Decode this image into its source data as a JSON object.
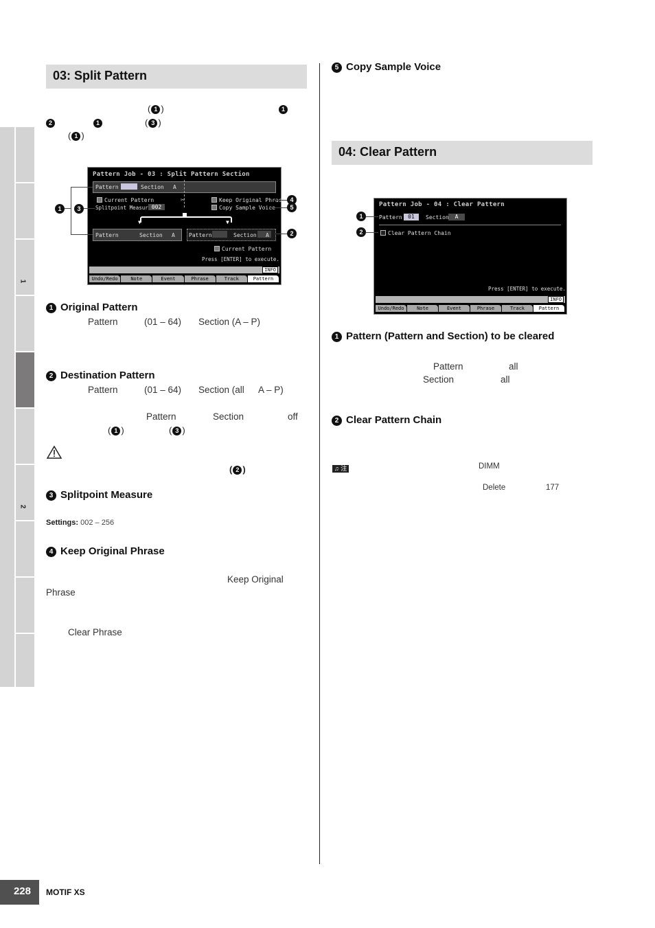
{
  "side_tabs": {
    "labels": [
      "1",
      "2"
    ],
    "active_index": 4
  },
  "left": {
    "section_title": "03: Split Pattern",
    "intro_refs": [
      "(",
      "1",
      ")",
      "1",
      "2",
      "1",
      "(",
      "3",
      ")",
      "(",
      "1",
      ")"
    ],
    "screen": {
      "title": "Pattern Job - 03 : Split Pattern Section",
      "top_row": {
        "pattern_label": "Pattern",
        "pattern_value": "",
        "section_label": "Section",
        "section_value": "A"
      },
      "current_pattern": "Current Pattern",
      "splitpoint_label": "Splitpoint Measure",
      "splitpoint_value": "002",
      "keep_original_phrase": "Keep Original Phrase",
      "copy_sample_voice": "Copy Sample Voice",
      "bottom_left": {
        "pattern_label": "Pattern",
        "section_label": "Section",
        "section_value": "A"
      },
      "bottom_right": {
        "pattern_label": "Pattern",
        "section_label": "Section",
        "section_value": "A"
      },
      "dest_current_pattern": "Current Pattern",
      "execute_prompt": "Press [ENTER] to execute.",
      "info": "INFO",
      "tabs": [
        "Undo/Redo",
        "Note",
        "Event",
        "Phrase",
        "Track",
        "Pattern"
      ],
      "callouts": [
        "1",
        "2",
        "3",
        "4",
        "5"
      ]
    },
    "items": [
      {
        "num": "1",
        "title": "Original Pattern",
        "line": [
          "Pattern",
          "(01 – 64)",
          "Section (A – P)"
        ]
      },
      {
        "num": "2",
        "title": "Destination Pattern",
        "line": [
          "Pattern",
          "(01 – 64)",
          "Section (all",
          "A – P)"
        ],
        "line2": [
          "Pattern",
          "Section",
          "off"
        ],
        "refs": [
          "1",
          "3"
        ]
      },
      {
        "num": "3",
        "title": "Splitpoint Measure",
        "settings_label": "Settings:",
        "settings_value": "002 – 256"
      },
      {
        "num": "4",
        "title": "Keep Original Phrase",
        "words": [
          "Keep Original",
          "Phrase",
          "Clear Phrase"
        ]
      }
    ],
    "warning_ref": "2"
  },
  "right": {
    "item5": {
      "num": "5",
      "title": "Copy Sample Voice"
    },
    "section_title": "04: Clear Pattern",
    "screen": {
      "title": "Pattern Job - 04 : Clear Pattern",
      "pattern_label": "Pattern",
      "pattern_value": "01",
      "section_label": "Section",
      "section_value": "A",
      "clear_chain": "Clear Pattern Chain",
      "execute_prompt": "Press [ENTER] to execute.",
      "info": "INFO",
      "tabs": [
        "Undo/Redo",
        "Note",
        "Event",
        "Phrase",
        "Track",
        "Pattern"
      ],
      "callouts": [
        "1",
        "2"
      ]
    },
    "items": [
      {
        "num": "1",
        "title": "Pattern (Pattern and Section) to be cleared",
        "words": [
          "Pattern",
          "all",
          "Section",
          "all"
        ]
      },
      {
        "num": "2",
        "title": "Clear Pattern Chain"
      }
    ],
    "note": {
      "badge": "♫ 注",
      "words": [
        "DIMM",
        "Delete",
        "177"
      ]
    }
  },
  "footer": {
    "page": "228",
    "product": "MOTIF XS"
  }
}
